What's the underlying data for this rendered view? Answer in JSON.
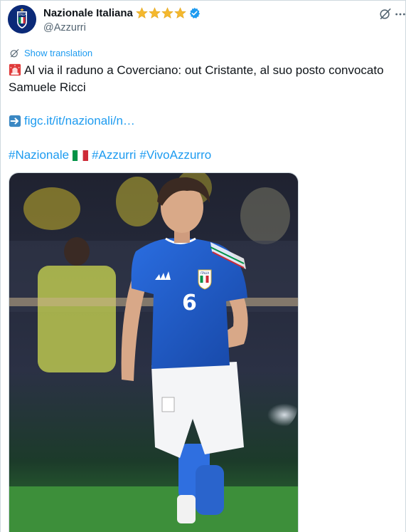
{
  "account": {
    "display_name": "Nazionale Italiana",
    "handle": "@Azzurri",
    "avatar_icon": "figc-crest-icon",
    "avatar_text": "ITALIA",
    "stars": 4,
    "verified": true
  },
  "header_actions": {
    "grok_icon": "grok-icon",
    "more_icon": "more-dots-icon"
  },
  "translation": {
    "label": "Show translation"
  },
  "tweet": {
    "text": "Al via il raduno a Coverciano: out Cristante, al suo posto convocato Samuele Ricci",
    "link": "figc.it/it/nazionali/n…",
    "hashtag_1": "#Nazionale",
    "hashtag_2": "#Azzurri",
    "hashtag_3": "#VivoAzzurro"
  },
  "media": {
    "jersey_number": "6",
    "crest_text": "ITALIA",
    "description_icon": "player-photo"
  },
  "colors": {
    "link": "#1d9bf0",
    "text": "#0f1419",
    "secondary": "#536471",
    "star": "#f4b82e",
    "verified": "#1d9bf0",
    "jersey": "#1f5fd1"
  }
}
